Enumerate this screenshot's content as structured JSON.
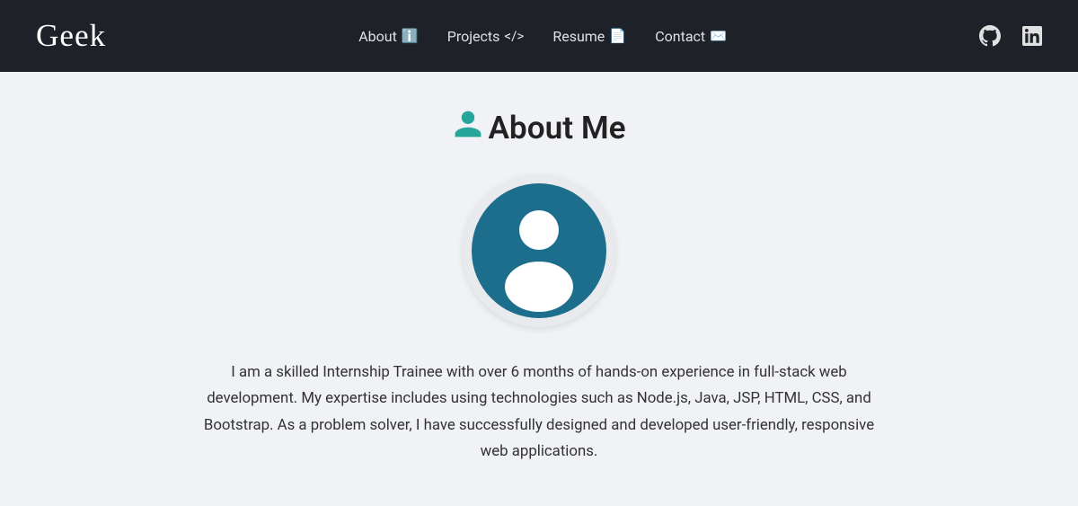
{
  "navbar": {
    "brand": "Geek",
    "links": [
      {
        "label": "About",
        "icon": "ℹ",
        "href": "#about"
      },
      {
        "label": "Projects",
        "icon": "</>",
        "href": "#projects"
      },
      {
        "label": "Resume",
        "icon": "📄",
        "href": "#resume"
      },
      {
        "label": "Contact",
        "icon": "✉",
        "href": "#contact"
      }
    ]
  },
  "section": {
    "title": "About Me",
    "bio": "I am a skilled Internship Trainee with over 6 months of hands-on experience in full-stack web development. My expertise includes using technologies such as Node.js, Java, JSP, HTML, CSS, and Bootstrap. As a problem solver, I have successfully designed and developed user-friendly, responsive web applications."
  },
  "colors": {
    "accent": "#26a69a",
    "avatar_bg": "#1d6d8c",
    "navbar_bg": "#1e2228"
  }
}
